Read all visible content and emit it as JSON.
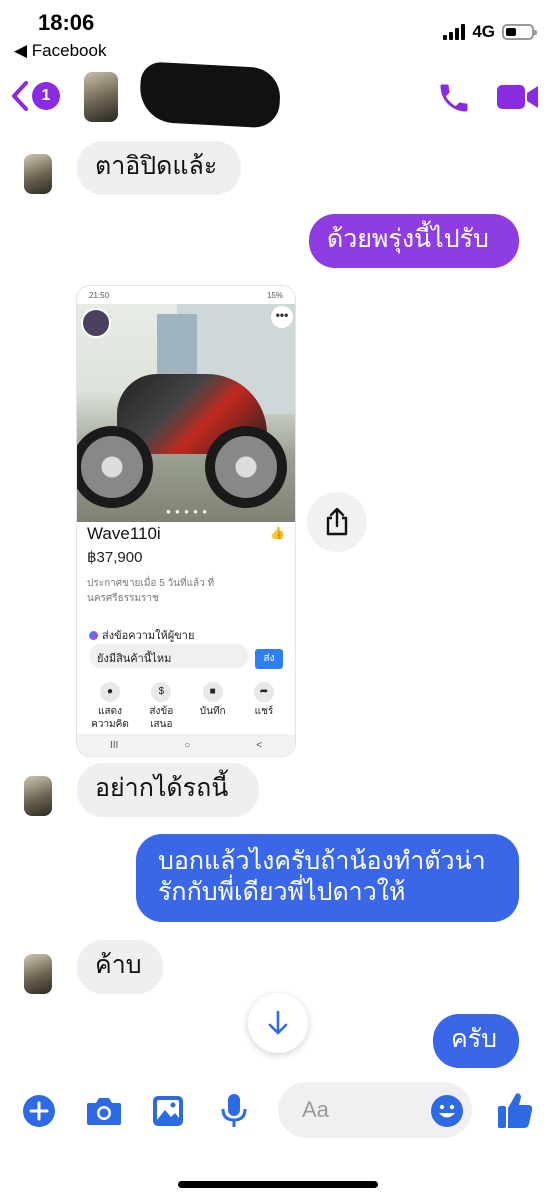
{
  "status_bar": {
    "time": "18:06",
    "back_app": "◀ Facebook",
    "network": "4G"
  },
  "header": {
    "unread_count": "1",
    "accent_color": "#8a2be2"
  },
  "messages": [
    {
      "from": "them",
      "text": "ตาอิปิดแล้ะ"
    },
    {
      "from": "me",
      "text": "ด้วยพรุ่งนี้ไปรับ"
    },
    {
      "from": "them",
      "type": "screenshot"
    },
    {
      "from": "them",
      "text": "อย่ากได้รถนี้"
    },
    {
      "from": "me",
      "text": "บอกแล้วไงครับถ้าน้องทำตัวน่ารักกับพี่เดียวพี่ไปดาวให้"
    },
    {
      "from": "them",
      "text": "ค้าบ"
    },
    {
      "from": "me",
      "text": "ครับ"
    }
  ],
  "shared_screenshot": {
    "status_time": "21:50",
    "status_right": "15%",
    "product_title": "Wave110i",
    "price": "฿37,900",
    "listing_info": "ประกาศขายเมื่อ 5 วันที่แล้ว ที่ นครศรีธรรมราช",
    "message_seller_label": "ส่งข้อความให้ผู้ขาย",
    "message_input_value": "ยังมีสินค้านี้ไหม",
    "send_label": "ส่ง",
    "actions": [
      "แสดงความคิด",
      "ส่งข้อเสนอ",
      "บันทึก",
      "แชร์"
    ],
    "nav": [
      "III",
      "○",
      "<"
    ]
  },
  "composer": {
    "placeholder": "Aa"
  },
  "colors": {
    "purple_bubble": "#8e3de2",
    "blue_bubble": "#3a66e8",
    "icon_blue": "#2d6ae3",
    "incoming_bubble": "#efefef"
  }
}
